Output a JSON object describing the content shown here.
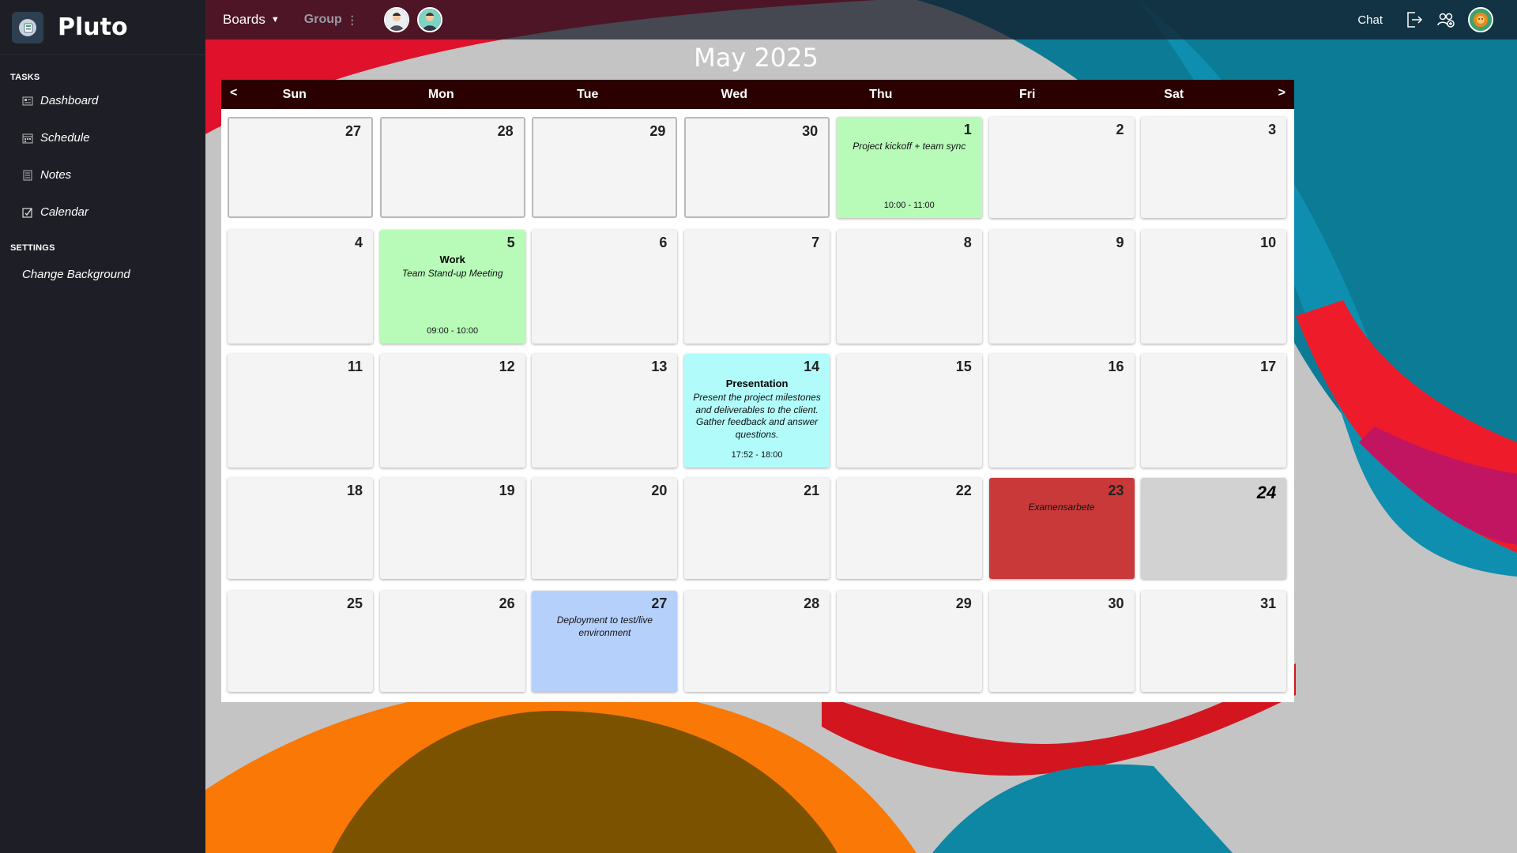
{
  "app": {
    "name": "Pluto"
  },
  "sidebar": {
    "sections": [
      {
        "title": "TASKS",
        "items": [
          {
            "label": "Dashboard",
            "icon": "dashboard-icon"
          },
          {
            "label": "Schedule",
            "icon": "schedule-icon"
          },
          {
            "label": "Notes",
            "icon": "notes-icon"
          },
          {
            "label": "Calendar",
            "icon": "calendar-icon"
          }
        ]
      },
      {
        "title": "SETTINGS",
        "items": [
          {
            "label": "Change Background"
          }
        ]
      }
    ]
  },
  "topbar": {
    "boards": "Boards",
    "group": "Group",
    "chat": "Chat"
  },
  "calendar": {
    "title": "May 2025",
    "prev": "<",
    "next": ">",
    "weekdays": [
      "Sun",
      "Mon",
      "Tue",
      "Wed",
      "Thu",
      "Fri",
      "Sat"
    ],
    "weeks": [
      [
        {
          "day": "27",
          "outside": true
        },
        {
          "day": "28",
          "outside": true
        },
        {
          "day": "29",
          "outside": true
        },
        {
          "day": "30",
          "outside": true
        },
        {
          "day": "1",
          "color": "#b8fbb8",
          "desc": "Project kickoff + team sync",
          "time": "10:00 - 11:00"
        },
        {
          "day": "2"
        },
        {
          "day": "3"
        }
      ],
      [
        {
          "day": "4"
        },
        {
          "day": "5",
          "color": "#b8fbb8",
          "title": "Work",
          "desc": "Team Stand-up Meeting",
          "time": "09:00 - 10:00"
        },
        {
          "day": "6"
        },
        {
          "day": "7"
        },
        {
          "day": "8"
        },
        {
          "day": "9"
        },
        {
          "day": "10"
        }
      ],
      [
        {
          "day": "11"
        },
        {
          "day": "12"
        },
        {
          "day": "13"
        },
        {
          "day": "14",
          "color": "#b1fbfb",
          "title": "Presentation",
          "desc": "Present the project milestones and deliverables to the client. Gather feedback and answer questions.",
          "time": "17:52 - 18:00"
        },
        {
          "day": "15"
        },
        {
          "day": "16"
        },
        {
          "day": "17"
        }
      ],
      [
        {
          "day": "18"
        },
        {
          "day": "19"
        },
        {
          "day": "20"
        },
        {
          "day": "21"
        },
        {
          "day": "22"
        },
        {
          "day": "23",
          "color": "#c9393a",
          "desc": "Examensarbete"
        },
        {
          "day": "24",
          "today": true,
          "color": "#d2d2d2"
        }
      ],
      [
        {
          "day": "25"
        },
        {
          "day": "26"
        },
        {
          "day": "27",
          "color": "#b5d0fb",
          "desc": "Deployment to test/live environment"
        },
        {
          "day": "28"
        },
        {
          "day": "29"
        },
        {
          "day": "30"
        },
        {
          "day": "31"
        }
      ]
    ]
  }
}
